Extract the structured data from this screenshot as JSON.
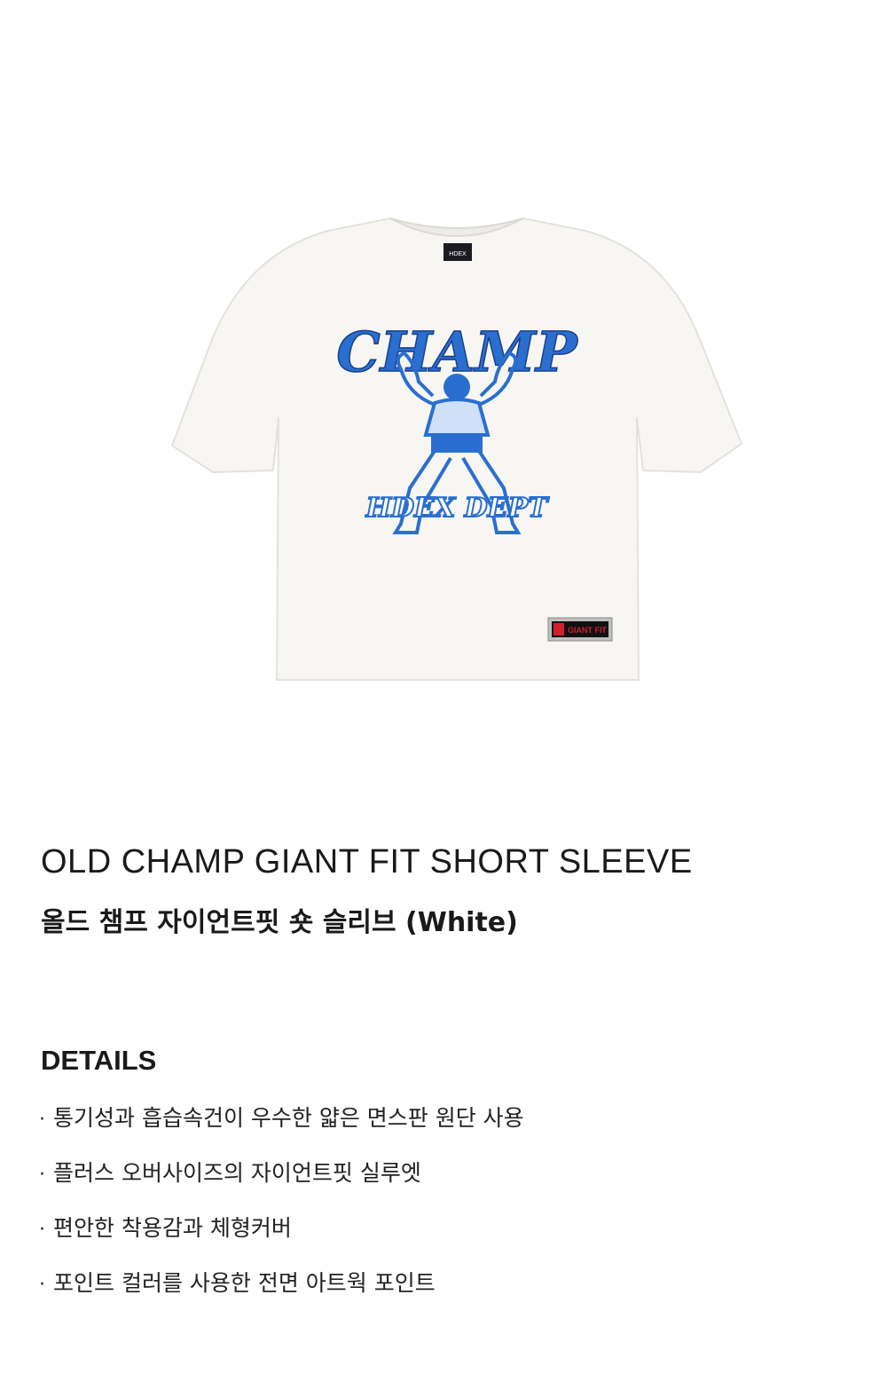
{
  "product": {
    "print_top": "CHAMP",
    "print_bottom": "HDEX DEPT",
    "neck_label": "HDEX",
    "hem_label": "GIANT FIT",
    "shirt_color": "#f7f6f3",
    "print_color": "#2a6fd0",
    "patch_color": "#d41f2c",
    "title_en": "OLD CHAMP GIANT FIT SHORT SLEEVE",
    "title_ko": "올드 챔프 자이언트핏 숏 슬리브 (White)"
  },
  "details": {
    "heading": "DETAILS",
    "bullet": "·",
    "items": [
      "통기성과 흡습속건이 우수한 얇은 면스판 원단 사용",
      "플러스 오버사이즈의 자이언트핏 실루엣",
      "편안한 착용감과 체형커버",
      "포인트 컬러를 사용한 전면 아트웍 포인트"
    ]
  }
}
